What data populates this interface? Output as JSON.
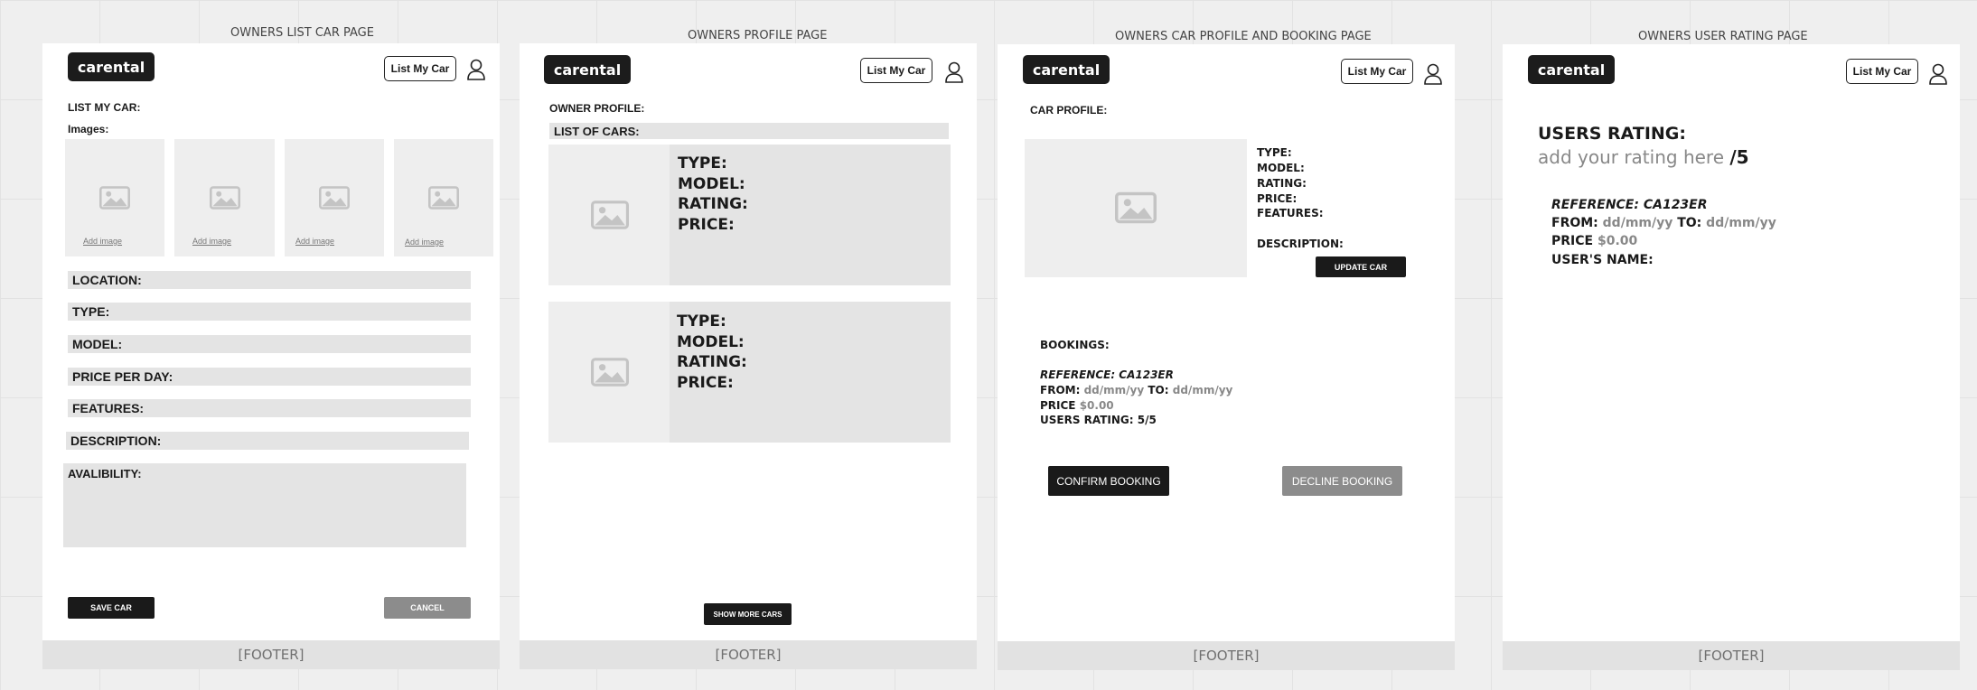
{
  "frames": {
    "list": "OWNERS LIST CAR PAGE",
    "profile": "OWNERS PROFILE PAGE",
    "car": "OWNERS CAR PROFILE AND BOOKING PAGE",
    "rating": "OWNERS USER RATING PAGE"
  },
  "common": {
    "logo": "carental",
    "list_my_car": "List My Car",
    "footer": "[FOOTER]"
  },
  "list_page": {
    "heading": "LIST MY CAR:",
    "images_label": "Images:",
    "add_image": "Add image",
    "fields": {
      "location": "LOCATION:",
      "type": "TYPE:",
      "model": "MODEL:",
      "price": "PRICE PER DAY:",
      "features": "FEATURES:",
      "description": "DESCRIPTION:",
      "availability": "AVALIBILITY:"
    },
    "save": "SAVE CAR",
    "cancel": "CANCEL"
  },
  "profile_page": {
    "heading": "OWNER PROFILE:",
    "list_label": "LIST OF CARS:",
    "card": {
      "type": "TYPE:",
      "model": "MODEL:",
      "rating": "RATING:",
      "price": "PRICE:"
    },
    "show_more": "SHOW MORE CARS"
  },
  "car_page": {
    "heading": "CAR PROFILE:",
    "type": "TYPE:",
    "model": "MODEL:",
    "rating": "RATING:",
    "price": "PRICE:",
    "features": "FEATURES:",
    "description": "DESCRIPTION:",
    "update": "UPDATE CAR",
    "bookings": "BOOKINGS:",
    "reference": "REFERENCE: CA123ER",
    "from_label": "FROM:",
    "date_placeholder": "dd/mm/yy",
    "to_label": "TO:",
    "price_label": "PRICE",
    "price_value": "$0.00",
    "users_rating": "USERS RATING: 5/5",
    "confirm": "CONFIRM BOOKING",
    "decline": "DECLINE BOOKING"
  },
  "rating_page": {
    "heading": "USERS RATING:",
    "placeholder": "add your rating here",
    "out_of": "/5",
    "reference": "REFERENCE: CA123ER",
    "from_label": "FROM:",
    "date_placeholder": "dd/mm/yy",
    "to_label": "TO:",
    "price_label": "PRICE",
    "price_value": "$0.00",
    "user_name": "USER'S NAME:"
  },
  "icons": {
    "user": "user-icon",
    "image": "image-placeholder-icon"
  }
}
